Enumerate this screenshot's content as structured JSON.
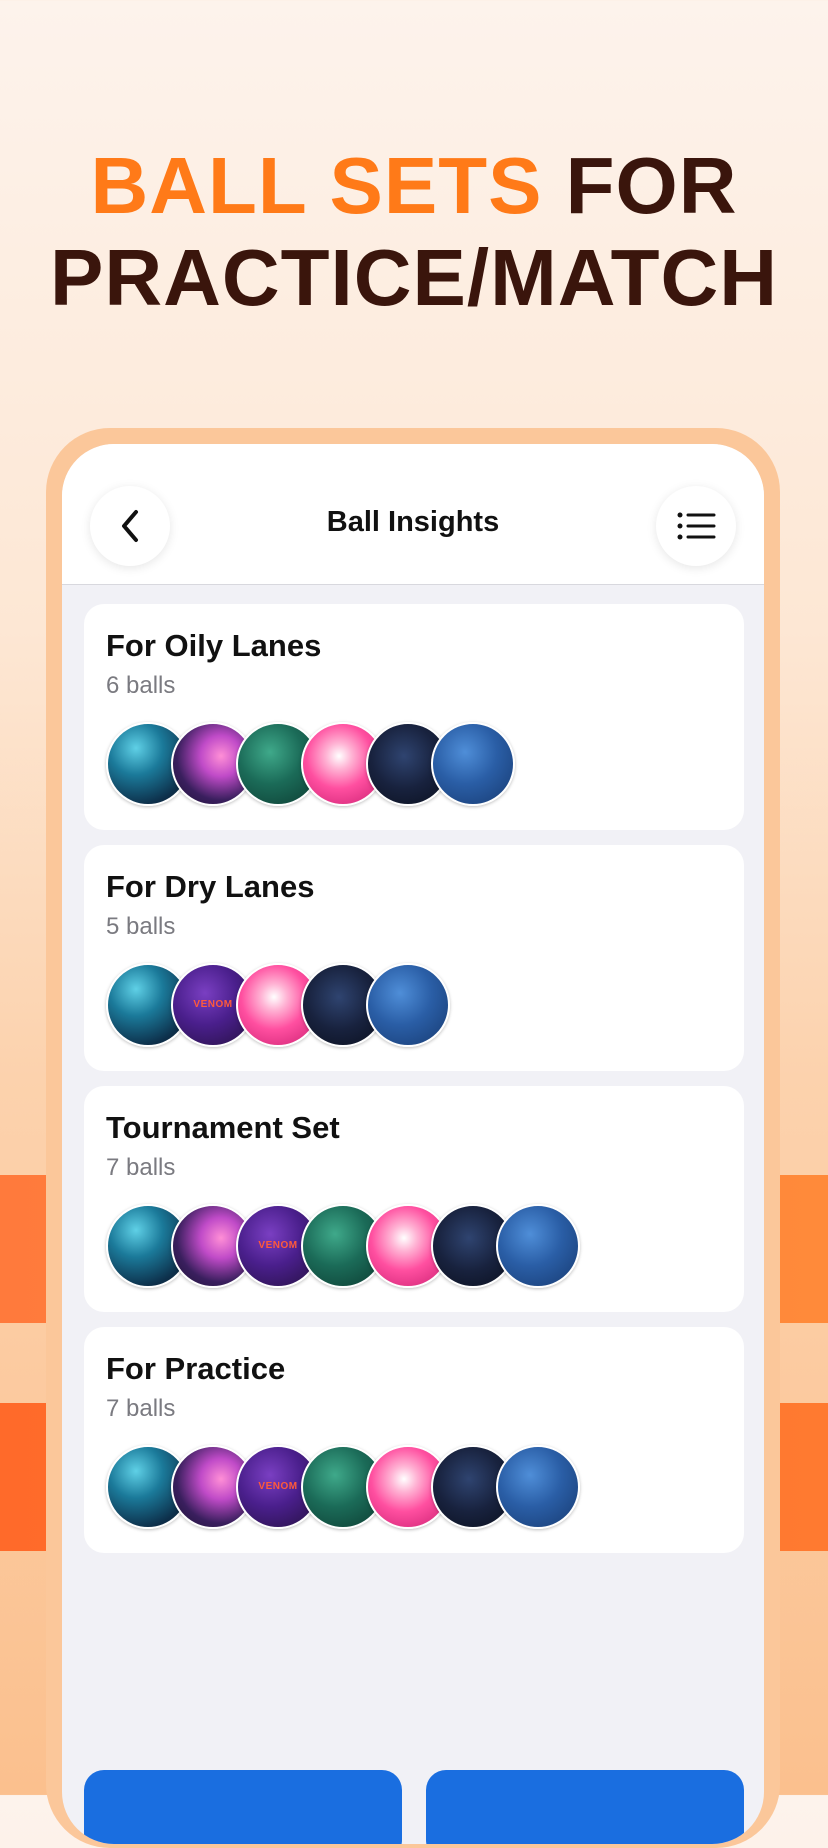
{
  "headline": {
    "accent": "BALL SETS",
    "rest_line1": " FOR",
    "line2": "PRACTICE/MATCH"
  },
  "colors": {
    "accent": "#ff7a18",
    "headline_dark": "#3a150c",
    "primary_button": "#1a6ee0"
  },
  "nav": {
    "title": "Ball Insights",
    "back_icon": "chevron-left-icon",
    "menu_icon": "list-icon"
  },
  "ball_sets": [
    {
      "title": "For Oily Lanes",
      "count": "6 balls",
      "balls": [
        "teal",
        "pink",
        "green",
        "hotpink",
        "navy",
        "blue"
      ]
    },
    {
      "title": "For Dry Lanes",
      "count": "5 balls",
      "balls": [
        "teal",
        "purple-venom",
        "hotpink",
        "navy",
        "blue"
      ]
    },
    {
      "title": "Tournament Set",
      "count": "7 balls",
      "balls": [
        "teal",
        "pink",
        "purple-venom",
        "green",
        "hotpink",
        "navy",
        "blue"
      ]
    },
    {
      "title": "For Practice",
      "count": "7 balls",
      "balls": [
        "teal",
        "pink",
        "purple-venom",
        "green",
        "hotpink",
        "navy",
        "blue"
      ]
    }
  ],
  "ball_label": {
    "venom": "VENOM"
  }
}
